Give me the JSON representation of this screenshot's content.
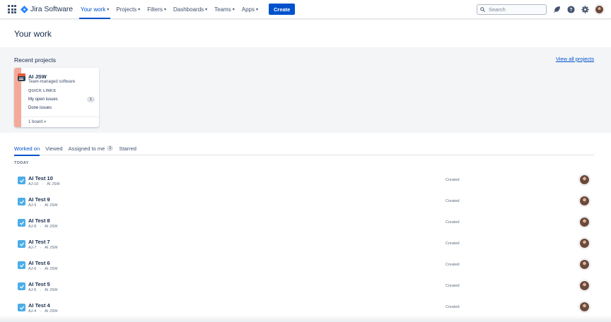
{
  "app": {
    "logo_text": "Jira Software"
  },
  "nav": {
    "items": [
      {
        "label": "Your work",
        "active": true
      },
      {
        "label": "Projects",
        "active": false
      },
      {
        "label": "Filters",
        "active": false
      },
      {
        "label": "Dashboards",
        "active": false
      },
      {
        "label": "Teams",
        "active": false
      },
      {
        "label": "Apps",
        "active": false
      }
    ],
    "create_label": "Create",
    "search_placeholder": "Search",
    "icons": [
      "notifications-icon",
      "help-icon",
      "settings-icon",
      "profile-avatar"
    ]
  },
  "page": {
    "title": "Your work"
  },
  "recent": {
    "title": "Recent projects",
    "view_all": "View all projects",
    "project": {
      "name": "AI JSW",
      "type": "Team-managed software",
      "quick_links_label": "QUICK LINKS",
      "links": [
        {
          "label": "My open issues",
          "count": "1"
        },
        {
          "label": "Done issues",
          "count": ""
        }
      ],
      "footer": "1 board"
    }
  },
  "tabs": {
    "items": [
      {
        "label": "Worked on",
        "active": true,
        "badge": ""
      },
      {
        "label": "Viewed",
        "active": false,
        "badge": ""
      },
      {
        "label": "Assigned to me",
        "active": false,
        "badge": "1"
      },
      {
        "label": "Starred",
        "active": false,
        "badge": ""
      }
    ]
  },
  "section": {
    "today_label": "TODAY"
  },
  "issues": [
    {
      "title": "AI Test 10",
      "key": "AJ-10",
      "project": "AI JSW",
      "status": "Created"
    },
    {
      "title": "AI Test 9",
      "key": "AJ-9",
      "project": "AI JSW",
      "status": "Created"
    },
    {
      "title": "AI Test 8",
      "key": "AJ-8",
      "project": "AI JSW",
      "status": "Created"
    },
    {
      "title": "AI Test 7",
      "key": "AJ-7",
      "project": "AI JSW",
      "status": "Created"
    },
    {
      "title": "AI Test 6",
      "key": "AJ-6",
      "project": "AI JSW",
      "status": "Created"
    },
    {
      "title": "AI Test 5",
      "key": "AJ-5",
      "project": "AI JSW",
      "status": "Created"
    },
    {
      "title": "AI Test 4",
      "key": "AJ-4",
      "project": "AI JSW",
      "status": "Created"
    }
  ],
  "colors": {
    "brand": "#0052CC",
    "task_icon": "#4BADE8",
    "project_stripe": "#F5A99A",
    "band_background": "#F4F5F7"
  }
}
